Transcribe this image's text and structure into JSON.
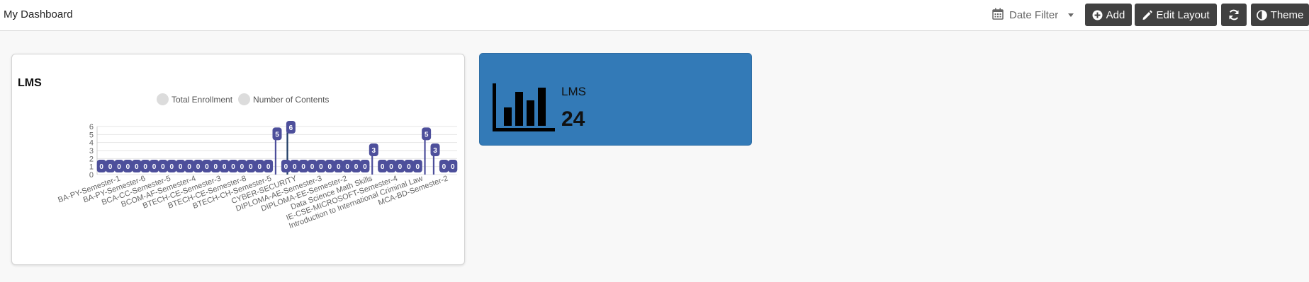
{
  "header": {
    "title": "My Dashboard",
    "date_filter_label": "Date Filter",
    "add_label": "Add",
    "edit_layout_label": "Edit Layout",
    "theme_label": "Theme"
  },
  "lms_chart_card": {
    "title": "LMS"
  },
  "chart_data": {
    "type": "bar",
    "title": "LMS",
    "series": [
      {
        "name": "Total Enrollment",
        "color": "#4d4f9b",
        "values": [
          0,
          0,
          0,
          0,
          0,
          0,
          0,
          0,
          0,
          0,
          0,
          0,
          0,
          0,
          0,
          0,
          0,
          0,
          0,
          0,
          5,
          0,
          0,
          0,
          0,
          0,
          0,
          0,
          0,
          0,
          0,
          3,
          0,
          0,
          0,
          0,
          0,
          5,
          3,
          0,
          0
        ]
      },
      {
        "name": "Number of Contents",
        "color": "#1f3c66",
        "values": [
          0,
          0,
          0,
          0,
          0,
          0,
          0,
          0,
          0,
          0,
          0,
          0,
          0,
          0,
          0,
          0,
          0,
          0,
          0,
          0,
          0,
          6,
          0,
          0,
          0,
          0,
          0,
          0,
          0,
          0,
          0,
          0,
          0,
          0,
          0,
          0,
          0,
          0,
          0,
          0,
          0
        ]
      }
    ],
    "category_count": 41,
    "tick_labels": [
      "BA-PY-Semester-1",
      "BA-PY-Semester-6",
      "BCA-CC-Semester-5",
      "BCOM-AF-Semester-4",
      "BTECH-CE-Semester-3",
      "BTECH-CE-Semester-8",
      "BTECH-CH-Semester-5",
      "CYBER-SECURITY",
      "DIPLOMA-AE-Semester-3",
      "DIPLOMA-EE-Semester-2",
      "Data Science Math Skills",
      "IE-CSE-MICROSOFT-Semester-4",
      "Introduction to International Criminal Law",
      "MCA-BD-Semester-2"
    ],
    "y_ticks": [
      "0",
      "1",
      "2",
      "3",
      "4",
      "5",
      "6"
    ],
    "ylim": [
      0,
      6
    ],
    "legend_position": "top",
    "grid": true,
    "data_labels": true
  },
  "lms_stat_card": {
    "label": "LMS",
    "value": "24",
    "icon": "bar-chart-icon",
    "background": "#337ab7"
  }
}
